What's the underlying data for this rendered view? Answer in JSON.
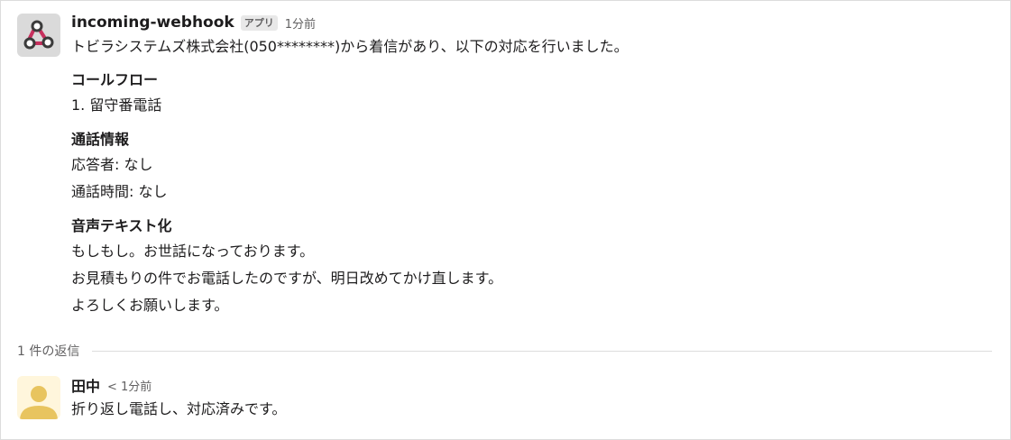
{
  "message": {
    "sender": "incoming-webhook",
    "badge": "アプリ",
    "time": "1分前",
    "intro": "トビラシステムズ株式会社(050********)から着信があり、以下の対応を行いました。",
    "sections": [
      {
        "title": "コールフロー",
        "lines": [
          "1. 留守番電話"
        ]
      },
      {
        "title": "通話情報",
        "lines": [
          "応答者: なし",
          "通話時間: なし"
        ]
      },
      {
        "title": "音声テキスト化",
        "lines": [
          "もしもし。お世話になっております。",
          "お見積もりの件でお電話したのですが、明日改めてかけ直します。",
          "よろしくお願いします。"
        ]
      }
    ]
  },
  "thread": {
    "reply_count": "1 件の返信"
  },
  "reply": {
    "name": "田中",
    "time": "< 1分前",
    "text": "折り返し電話し、対応済みです。"
  },
  "colors": {
    "webhook_icon": "#e01e5a",
    "avatar_yellow": "#e8c45f"
  }
}
